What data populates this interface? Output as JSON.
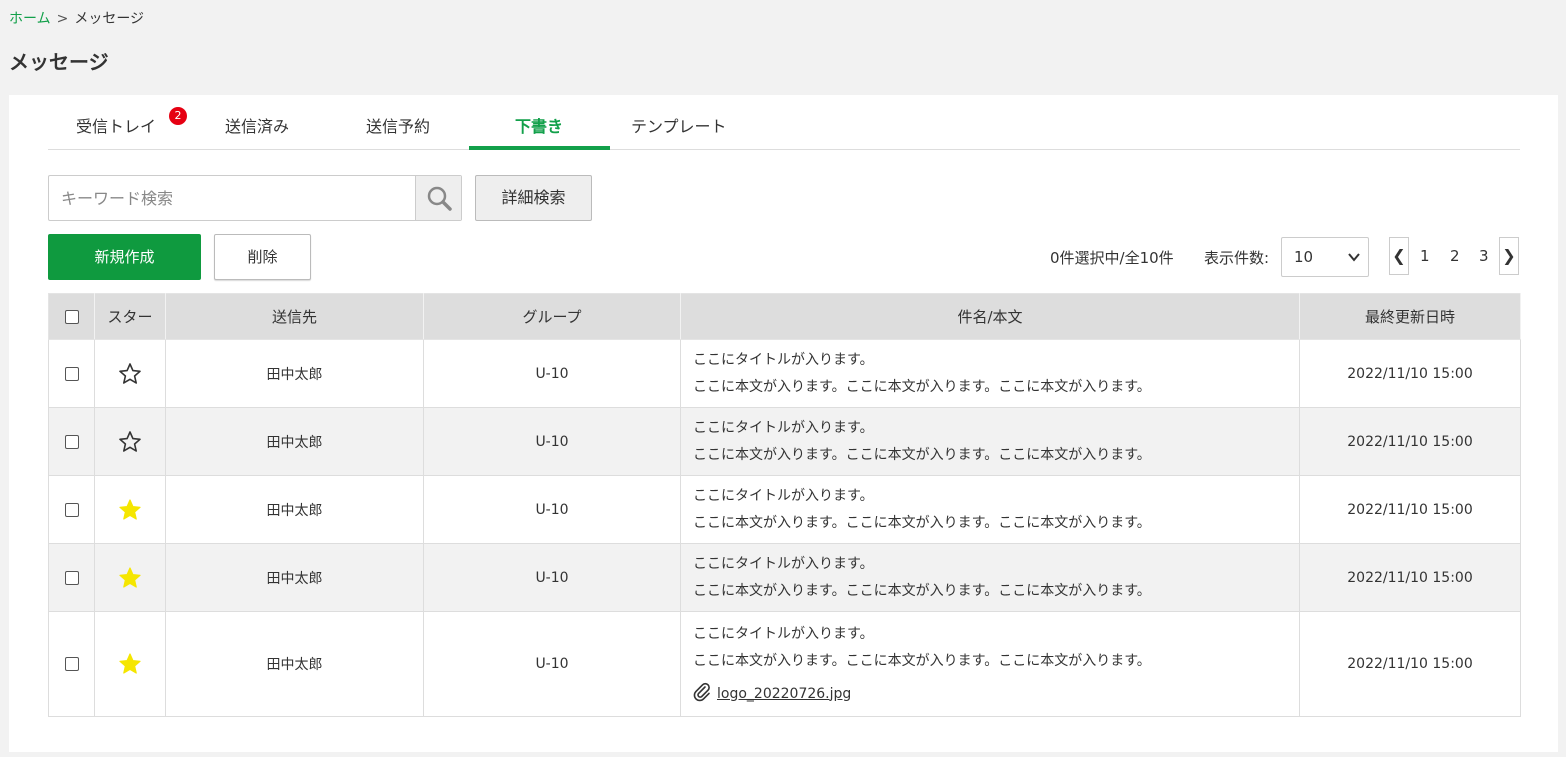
{
  "breadcrumb": {
    "home": "ホーム",
    "sep": ">",
    "current": "メッセージ"
  },
  "page": {
    "title": "メッセージ"
  },
  "tabs": [
    {
      "label": "受信トレイ",
      "badge": "2"
    },
    {
      "label": "送信済み"
    },
    {
      "label": "送信予約"
    },
    {
      "label": "下書き",
      "active": true
    },
    {
      "label": "テンプレート"
    }
  ],
  "search": {
    "placeholder": "キーワード検索",
    "value": "",
    "advanced_label": "詳細検索"
  },
  "actions": {
    "new_label": "新規作成",
    "delete_label": "削除"
  },
  "list_info": {
    "selection": "0件選択中/全10件",
    "per_page_label": "表示件数:",
    "per_page_value": "10"
  },
  "pagination": {
    "prev": "❮",
    "next": "❯",
    "pages": [
      "1",
      "2",
      "3"
    ]
  },
  "table": {
    "headers": {
      "star": "スター",
      "to": "送信先",
      "group": "グループ",
      "subject": "件名/本文",
      "updated": "最終更新日時"
    },
    "rows": [
      {
        "starred": false,
        "to": "田中太郎",
        "group": "U-10",
        "title": "ここにタイトルが入ります。",
        "body": "ここに本文が入ります。ここに本文が入ります。ここに本文が入ります。",
        "updated": "2022/11/10 15:00"
      },
      {
        "starred": false,
        "to": "田中太郎",
        "group": "U-10",
        "title": "ここにタイトルが入ります。",
        "body": "ここに本文が入ります。ここに本文が入ります。ここに本文が入ります。",
        "updated": "2022/11/10 15:00"
      },
      {
        "starred": true,
        "to": "田中太郎",
        "group": "U-10",
        "title": "ここにタイトルが入ります。",
        "body": "ここに本文が入ります。ここに本文が入ります。ここに本文が入ります。",
        "updated": "2022/11/10 15:00"
      },
      {
        "starred": true,
        "to": "田中太郎",
        "group": "U-10",
        "title": "ここにタイトルが入ります。",
        "body": "ここに本文が入ります。ここに本文が入ります。ここに本文が入ります。",
        "updated": "2022/11/10 15:00"
      },
      {
        "starred": true,
        "to": "田中太郎",
        "group": "U-10",
        "title": "ここにタイトルが入ります。",
        "body": "ここに本文が入ります。ここに本文が入ります。ここに本文が入ります。",
        "attachment": "logo_20220726.jpg",
        "updated": "2022/11/10 15:00"
      }
    ]
  },
  "colors": {
    "accent": "#0f9a3f",
    "badge": "#e60012",
    "star_on": "#f5e600"
  },
  "icons": {
    "search": "magnifier-icon",
    "star_on": "star-filled-icon",
    "star_off": "star-outline-icon",
    "attachment": "paperclip-icon"
  }
}
